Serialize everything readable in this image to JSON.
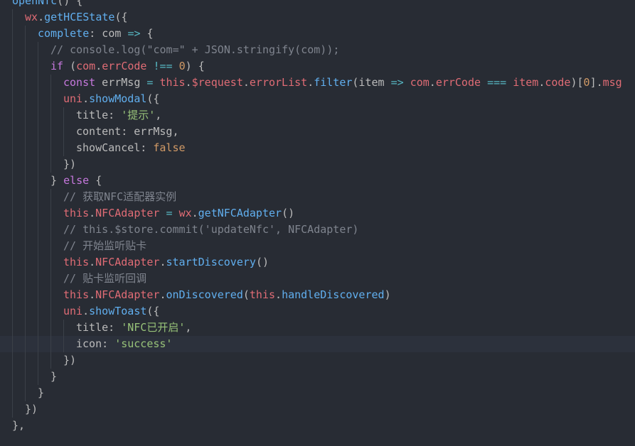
{
  "colors": {
    "background": "#282c34",
    "current_line": "#2c313c",
    "indent_guide": "#3b4048",
    "plain": "#bbbbbb",
    "function": "#61afef",
    "keyword": "#c678dd",
    "property": "#e06c75",
    "number": "#d19a66",
    "string": "#98c379",
    "comment": "#7f848e",
    "operator": "#56b6c2"
  },
  "current_line_index": 21,
  "lines": [
    {
      "indent": 0,
      "tokens": [
        [
          "func",
          "openNfc"
        ],
        [
          "plain",
          "() {"
        ]
      ]
    },
    {
      "indent": 1,
      "tokens": [
        [
          "prop",
          "wx"
        ],
        [
          "plain",
          "."
        ],
        [
          "func",
          "getHCEState"
        ],
        [
          "plain",
          "({"
        ]
      ]
    },
    {
      "indent": 2,
      "tokens": [
        [
          "func",
          "complete"
        ],
        [
          "plain",
          ": com "
        ],
        [
          "op",
          "=>"
        ],
        [
          "plain",
          " {"
        ]
      ]
    },
    {
      "indent": 3,
      "tokens": [
        [
          "comment",
          "// console.log(\"com=\" + JSON.stringify(com));"
        ]
      ]
    },
    {
      "indent": 3,
      "tokens": [
        [
          "keyword",
          "if"
        ],
        [
          "plain",
          " ("
        ],
        [
          "prop",
          "com"
        ],
        [
          "plain",
          "."
        ],
        [
          "prop",
          "errCode"
        ],
        [
          "plain",
          " "
        ],
        [
          "op",
          "!=="
        ],
        [
          "plain",
          " "
        ],
        [
          "number",
          "0"
        ],
        [
          "plain",
          ") {"
        ]
      ]
    },
    {
      "indent": 4,
      "tokens": [
        [
          "keyword",
          "const"
        ],
        [
          "plain",
          " errMsg "
        ],
        [
          "op",
          "="
        ],
        [
          "plain",
          " "
        ],
        [
          "prop",
          "this"
        ],
        [
          "plain",
          "."
        ],
        [
          "prop",
          "$request"
        ],
        [
          "plain",
          "."
        ],
        [
          "prop",
          "errorList"
        ],
        [
          "plain",
          "."
        ],
        [
          "func",
          "filter"
        ],
        [
          "plain",
          "(item "
        ],
        [
          "op",
          "=>"
        ],
        [
          "plain",
          " "
        ],
        [
          "prop",
          "com"
        ],
        [
          "plain",
          "."
        ],
        [
          "prop",
          "errCode"
        ],
        [
          "plain",
          " "
        ],
        [
          "op",
          "==="
        ],
        [
          "plain",
          " "
        ],
        [
          "prop",
          "item"
        ],
        [
          "plain",
          "."
        ],
        [
          "prop",
          "code"
        ],
        [
          "plain",
          ")["
        ],
        [
          "number",
          "0"
        ],
        [
          "plain",
          "]."
        ],
        [
          "prop",
          "msg"
        ]
      ]
    },
    {
      "indent": 4,
      "tokens": [
        [
          "prop",
          "uni"
        ],
        [
          "plain",
          "."
        ],
        [
          "func",
          "showModal"
        ],
        [
          "plain",
          "({"
        ]
      ]
    },
    {
      "indent": 5,
      "tokens": [
        [
          "plain",
          "title: "
        ],
        [
          "string",
          "'提示'"
        ],
        [
          "plain",
          ","
        ]
      ]
    },
    {
      "indent": 5,
      "tokens": [
        [
          "plain",
          "content: errMsg,"
        ]
      ]
    },
    {
      "indent": 5,
      "tokens": [
        [
          "plain",
          "showCancel: "
        ],
        [
          "number",
          "false"
        ]
      ]
    },
    {
      "indent": 4,
      "tokens": [
        [
          "plain",
          "})"
        ]
      ]
    },
    {
      "indent": 3,
      "tokens": [
        [
          "plain",
          "} "
        ],
        [
          "keyword",
          "else"
        ],
        [
          "plain",
          " {"
        ]
      ]
    },
    {
      "indent": 4,
      "tokens": [
        [
          "comment",
          "// 获取NFC适配器实例"
        ]
      ]
    },
    {
      "indent": 4,
      "tokens": [
        [
          "prop",
          "this"
        ],
        [
          "plain",
          "."
        ],
        [
          "prop",
          "NFCAdapter"
        ],
        [
          "plain",
          " "
        ],
        [
          "op",
          "="
        ],
        [
          "plain",
          " "
        ],
        [
          "prop",
          "wx"
        ],
        [
          "plain",
          "."
        ],
        [
          "func",
          "getNFCAdapter"
        ],
        [
          "plain",
          "()"
        ]
      ]
    },
    {
      "indent": 4,
      "tokens": [
        [
          "comment",
          "// this.$store.commit('updateNfc', NFCAdapter)"
        ]
      ]
    },
    {
      "indent": 4,
      "tokens": [
        [
          "comment",
          "// 开始监听贴卡"
        ]
      ]
    },
    {
      "indent": 4,
      "tokens": [
        [
          "prop",
          "this"
        ],
        [
          "plain",
          "."
        ],
        [
          "prop",
          "NFCAdapter"
        ],
        [
          "plain",
          "."
        ],
        [
          "func",
          "startDiscovery"
        ],
        [
          "plain",
          "()"
        ]
      ]
    },
    {
      "indent": 4,
      "tokens": [
        [
          "comment",
          "// 贴卡监听回调"
        ]
      ]
    },
    {
      "indent": 4,
      "tokens": [
        [
          "prop",
          "this"
        ],
        [
          "plain",
          "."
        ],
        [
          "prop",
          "NFCAdapter"
        ],
        [
          "plain",
          "."
        ],
        [
          "func",
          "onDiscovered"
        ],
        [
          "plain",
          "("
        ],
        [
          "prop",
          "this"
        ],
        [
          "plain",
          "."
        ],
        [
          "func",
          "handleDiscovered"
        ],
        [
          "plain",
          ")"
        ]
      ]
    },
    {
      "indent": 4,
      "tokens": [
        [
          "prop",
          "uni"
        ],
        [
          "plain",
          "."
        ],
        [
          "func",
          "showToast"
        ],
        [
          "plain",
          "({"
        ]
      ]
    },
    {
      "indent": 5,
      "tokens": [
        [
          "plain",
          "title: "
        ],
        [
          "string",
          "'NFC已开启'"
        ],
        [
          "plain",
          ","
        ]
      ]
    },
    {
      "indent": 5,
      "tokens": [
        [
          "plain",
          "icon: "
        ],
        [
          "string",
          "'success'"
        ]
      ]
    },
    {
      "indent": 4,
      "tokens": [
        [
          "plain",
          "})"
        ]
      ]
    },
    {
      "indent": 3,
      "tokens": [
        [
          "plain",
          "}"
        ]
      ]
    },
    {
      "indent": 2,
      "tokens": [
        [
          "plain",
          "}"
        ]
      ]
    },
    {
      "indent": 1,
      "tokens": [
        [
          "plain",
          "})"
        ]
      ]
    },
    {
      "indent": 0,
      "tokens": [
        [
          "plain",
          "},"
        ]
      ]
    }
  ]
}
